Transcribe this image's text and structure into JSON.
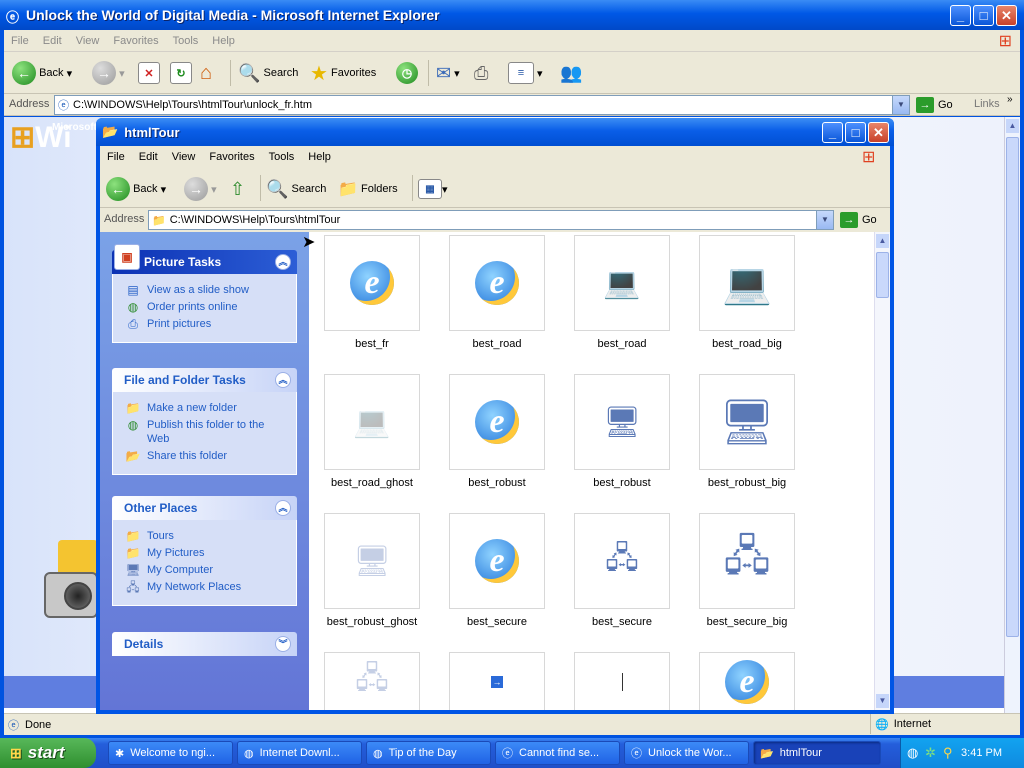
{
  "ie": {
    "title": "Unlock the World of Digital Media - Microsoft Internet Explorer",
    "menu": [
      "File",
      "Edit",
      "View",
      "Favorites",
      "Tools",
      "Help"
    ],
    "toolbar": {
      "back": "Back",
      "search": "Search",
      "favorites": "Favorites"
    },
    "address_label": "Address",
    "address": "C:\\WINDOWS\\Help\\Tours\\htmlTour\\unlock_fr.htm",
    "go": "Go",
    "links": "Links",
    "logo_small": "Microsoft",
    "logo_text": "Wi",
    "status": {
      "left": "Done",
      "zone": "Internet"
    }
  },
  "explorer": {
    "title": "htmlTour",
    "menu": [
      "File",
      "Edit",
      "View",
      "Favorites",
      "Tools",
      "Help"
    ],
    "toolbar": {
      "back": "Back",
      "search": "Search",
      "folders": "Folders"
    },
    "address_label": "Address",
    "address": "C:\\WINDOWS\\Help\\Tours\\htmlTour",
    "go": "Go",
    "panels": {
      "picture_tasks": {
        "title": "Picture Tasks",
        "items": [
          "View as a slide show",
          "Order prints online",
          "Print pictures"
        ]
      },
      "file_folder_tasks": {
        "title": "File and Folder Tasks",
        "items": [
          "Make a new folder",
          "Publish this folder to the Web",
          "Share this folder"
        ]
      },
      "other_places": {
        "title": "Other Places",
        "items": [
          "Tours",
          "My Pictures",
          "My Computer",
          "My Network Places"
        ]
      },
      "details": {
        "title": "Details"
      }
    },
    "files": [
      "best_fr",
      "best_road",
      "best_road",
      "best_road_big",
      "best_road_ghost",
      "best_robust",
      "best_robust",
      "best_robust_big",
      "best_robust_ghost",
      "best_secure",
      "best_secure",
      "best_secure_big"
    ]
  },
  "taskbar": {
    "start": "start",
    "tasks": [
      "Welcome to ngi...",
      "Internet Downl...",
      "Tip of the Day",
      "Cannot find se...",
      "Unlock the Wor...",
      "htmlTour"
    ],
    "clock": "3:41 PM"
  }
}
